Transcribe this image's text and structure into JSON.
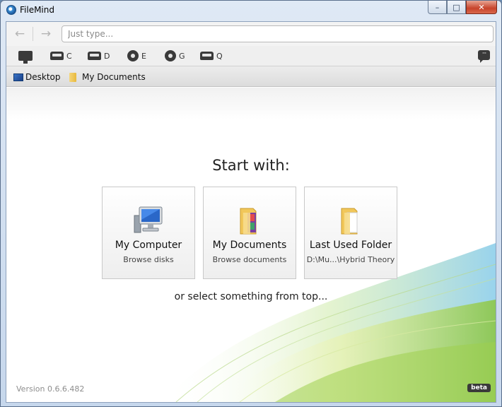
{
  "window": {
    "title": "FileMind",
    "controls": {
      "minimize": "–",
      "maximize": "□",
      "close": "✕"
    }
  },
  "nav": {
    "back_glyph": "←",
    "forward_glyph": "→",
    "search_placeholder": "Just type..."
  },
  "drives": [
    {
      "letter": "",
      "icon": "computer-icon"
    },
    {
      "letter": "C",
      "icon": "hdd-icon"
    },
    {
      "letter": "D",
      "icon": "hdd-icon"
    },
    {
      "letter": "E",
      "icon": "cd-icon"
    },
    {
      "letter": "G",
      "icon": "cd-icon"
    },
    {
      "letter": "Q",
      "icon": "hdd-icon"
    }
  ],
  "feedback_glyph": "···",
  "favorites": [
    {
      "label": "Desktop",
      "icon": "desktop-icon"
    },
    {
      "label": "My Documents",
      "icon": "folder-icon"
    }
  ],
  "main": {
    "heading": "Start with:",
    "tiles": [
      {
        "title": "My Computer",
        "subtitle": "Browse disks",
        "icon": "computer-icon"
      },
      {
        "title": "My Documents",
        "subtitle": "Browse documents",
        "icon": "documents-folder-icon"
      },
      {
        "title": "Last Used Folder",
        "subtitle": "D:\\Mu...\\Hybrid Theory",
        "icon": "folder-icon"
      }
    ],
    "hint": "or select something from top..."
  },
  "footer": {
    "version": "Version 0.6.6.482",
    "badge": "beta"
  },
  "colors": {
    "dark_icon": "#3a3a3a",
    "wave_green": "#8cc63f",
    "wave_blue": "#7fc8e8",
    "close_red": "#c7432b"
  }
}
